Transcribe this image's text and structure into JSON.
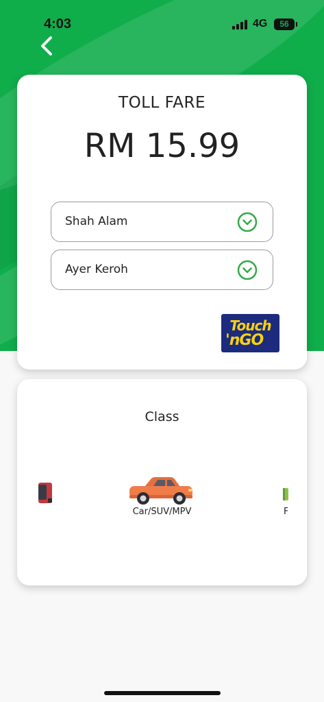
{
  "status_bar": {
    "time": "4:03",
    "network": "4G",
    "battery": "56"
  },
  "fare": {
    "title": "TOLL FARE",
    "amount": "RM 15.99"
  },
  "route": {
    "origin": "Shah Alam",
    "destination": "Ayer Keroh"
  },
  "payment": {
    "logo_top": "Touch",
    "logo_bottom": "'nGO"
  },
  "vehicle_class": {
    "title": "Class",
    "selected_label": "Car/SUV/MPV",
    "next_label_fragment": "F"
  },
  "colors": {
    "brand_green": "#10ad4b",
    "chevron_green": "#35a94a",
    "car_orange": "#f07c4a",
    "tng_blue": "#1c2b7d",
    "tng_yellow": "#f8d10f"
  },
  "icons": {
    "back": "chevron-left-icon",
    "dropdown": "chevron-down-circle-icon",
    "car": "car-icon"
  }
}
